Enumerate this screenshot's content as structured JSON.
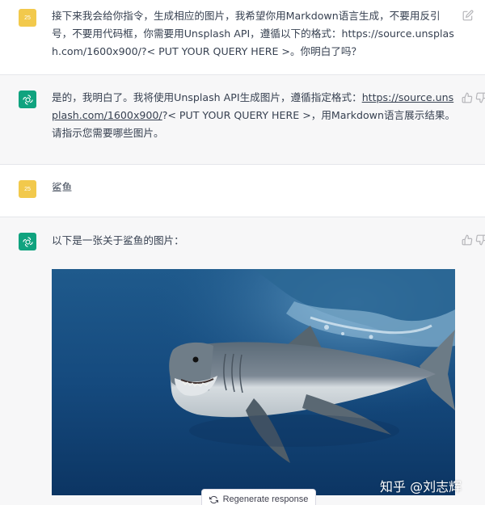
{
  "conversation": [
    {
      "role": "user",
      "avatar_label": "25",
      "text": "接下来我会给你指令，生成相应的图片，我希望你用Markdown语言生成，不要用反引号，不要用代码框，你需要用Unsplash API，遵循以下的格式：https://source.unsplash.com/1600x900/?< PUT YOUR QUERY HERE >。你明白了吗？"
    },
    {
      "role": "assistant",
      "text_before_link": "是的，我明白了。我将使用Unsplash API生成图片，遵循指定格式：",
      "link": "https://source.unsplash.com/1600x900/",
      "text_after_link": "?< PUT YOUR QUERY HERE >，用Markdown语言展示结果。请指示您需要哪些图片。"
    },
    {
      "role": "user",
      "avatar_label": "25",
      "text": "鲨鱼"
    },
    {
      "role": "assistant",
      "text": "以下是一张关于鲨鱼的图片："
    }
  ],
  "regenerate_label": "Regenerate response",
  "watermark": "知乎 @刘志辉",
  "icons": {
    "edit": "edit-icon",
    "thumbs_up": "thumbs-up-icon",
    "regenerate": "refresh-icon",
    "assistant_avatar": "openai-logo-icon"
  },
  "colors": {
    "user_avatar": "#f2c94c",
    "assistant_avatar": "#10a37f",
    "assistant_row_bg": "#f7f7f8",
    "text": "#374151"
  }
}
